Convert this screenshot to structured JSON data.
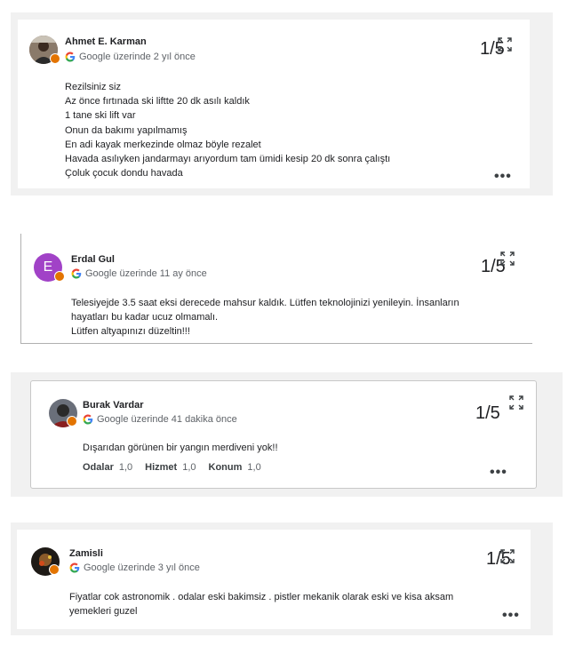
{
  "reviews": [
    {
      "author": "Ahmet E. Karman",
      "source": "Google üzerinde 2 yıl önce",
      "avatar_color": "#6d4c41",
      "lines": [
        "Rezilsiniz siz",
        "Az önce fırtınada ski liftte 20 dk asılı kaldık",
        "1 tane ski lift var",
        "Onun da bakımı yapılmamış",
        "En adi kayak merkezinde olmaz böyle rezalet",
        "Havada asılıyken jandarmayı arıyordum tam ümidi kesip 20 dk sonra çalıştı",
        "Çoluk çocuk dondu havada"
      ],
      "counter": "1/5"
    },
    {
      "author": "Erdal Gul",
      "source": "Google üzerinde 11 ay önce",
      "avatar_letter": "E",
      "avatar_color": "#a142c7",
      "lines": [
        "Telesiyejde 3.5 saat eksi derecede mahsur kaldık. Lütfen teknolojinizi yenileyin. İnsanların",
        "hayatları bu kadar ucuz olmamalı.",
        "Lütfen altyapınızı düzeltin!!!"
      ],
      "counter": "1/5"
    },
    {
      "author": "Burak Vardar",
      "source": "Google üzerinde 41 dakika önce",
      "avatar_color": "#4a5060",
      "lines": [
        "Dışarıdan görünen bir yangın merdiveni yok!!"
      ],
      "ratings": [
        {
          "label": "Odalar",
          "value": "1,0"
        },
        {
          "label": "Hizmet",
          "value": "1,0"
        },
        {
          "label": "Konum",
          "value": "1,0"
        }
      ],
      "counter": "1/5"
    },
    {
      "author": "Zamisli",
      "source": "Google üzerinde 3 yıl önce",
      "avatar_color": "#3a2a1a",
      "lines": [
        "Fiyatlar cok astronomik . odalar eski bakimsiz . pistler mekanik olarak eski ve kisa aksam",
        "yemekleri guzel"
      ],
      "counter": "1/5"
    }
  ],
  "icons": {
    "google": "google-g-icon",
    "expand": "expand-icon",
    "more": "more-options-icon"
  },
  "more_glyph": "•••"
}
